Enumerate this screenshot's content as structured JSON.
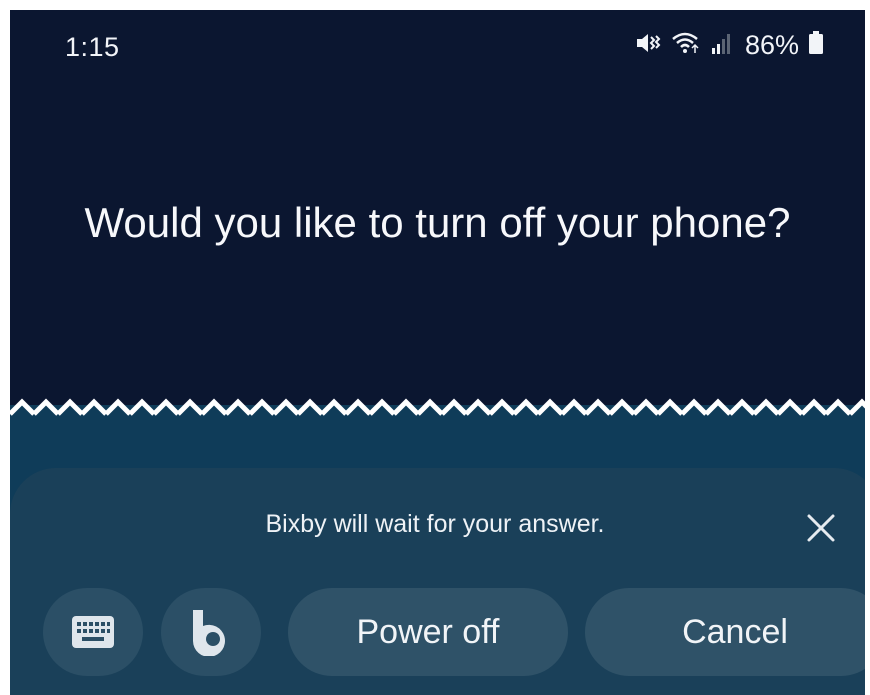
{
  "status_bar": {
    "time": "1:15",
    "battery_percent": "86%",
    "icons": [
      "mute-vibrate-icon",
      "wifi-icon",
      "signal-icon",
      "battery-icon"
    ]
  },
  "dialog": {
    "question": "Would you like to turn off your phone?"
  },
  "response_card": {
    "message": "Bixby will wait for your answer.",
    "close_icon": "close-icon",
    "keyboard_icon": "keyboard-icon",
    "bixby_icon": "bixby-icon",
    "power_off_label": "Power off",
    "cancel_label": "Cancel"
  },
  "colors": {
    "background_top": "#0b1630",
    "background_bottom": "#0f3c59",
    "card": "#1a4059",
    "button": "#2f5268",
    "text": "#f2f4f8"
  }
}
